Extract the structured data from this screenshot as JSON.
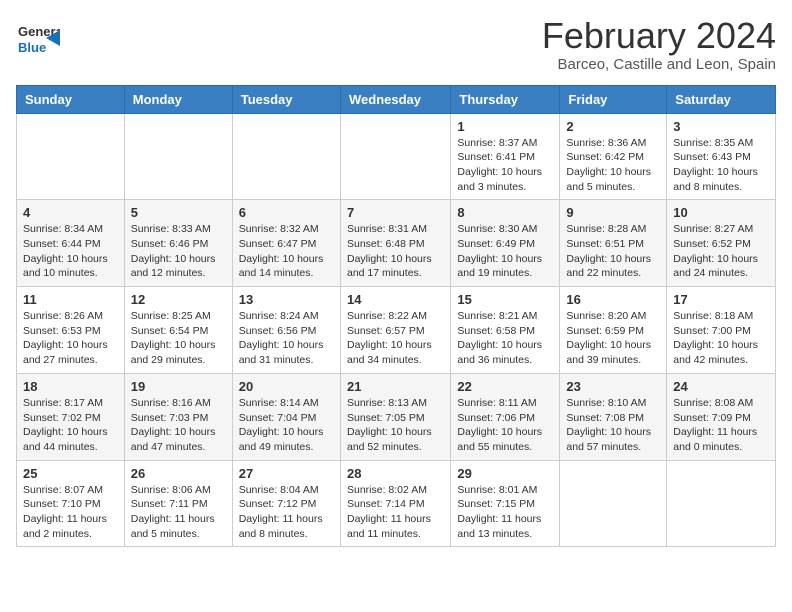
{
  "logo": {
    "text_general": "General",
    "text_blue": "Blue"
  },
  "title": "February 2024",
  "subtitle": "Barceo, Castille and Leon, Spain",
  "days_of_week": [
    "Sunday",
    "Monday",
    "Tuesday",
    "Wednesday",
    "Thursday",
    "Friday",
    "Saturday"
  ],
  "weeks": [
    [
      {
        "day": "",
        "info": ""
      },
      {
        "day": "",
        "info": ""
      },
      {
        "day": "",
        "info": ""
      },
      {
        "day": "",
        "info": ""
      },
      {
        "day": "1",
        "info": "Sunrise: 8:37 AM\nSunset: 6:41 PM\nDaylight: 10 hours\nand 3 minutes."
      },
      {
        "day": "2",
        "info": "Sunrise: 8:36 AM\nSunset: 6:42 PM\nDaylight: 10 hours\nand 5 minutes."
      },
      {
        "day": "3",
        "info": "Sunrise: 8:35 AM\nSunset: 6:43 PM\nDaylight: 10 hours\nand 8 minutes."
      }
    ],
    [
      {
        "day": "4",
        "info": "Sunrise: 8:34 AM\nSunset: 6:44 PM\nDaylight: 10 hours\nand 10 minutes."
      },
      {
        "day": "5",
        "info": "Sunrise: 8:33 AM\nSunset: 6:46 PM\nDaylight: 10 hours\nand 12 minutes."
      },
      {
        "day": "6",
        "info": "Sunrise: 8:32 AM\nSunset: 6:47 PM\nDaylight: 10 hours\nand 14 minutes."
      },
      {
        "day": "7",
        "info": "Sunrise: 8:31 AM\nSunset: 6:48 PM\nDaylight: 10 hours\nand 17 minutes."
      },
      {
        "day": "8",
        "info": "Sunrise: 8:30 AM\nSunset: 6:49 PM\nDaylight: 10 hours\nand 19 minutes."
      },
      {
        "day": "9",
        "info": "Sunrise: 8:28 AM\nSunset: 6:51 PM\nDaylight: 10 hours\nand 22 minutes."
      },
      {
        "day": "10",
        "info": "Sunrise: 8:27 AM\nSunset: 6:52 PM\nDaylight: 10 hours\nand 24 minutes."
      }
    ],
    [
      {
        "day": "11",
        "info": "Sunrise: 8:26 AM\nSunset: 6:53 PM\nDaylight: 10 hours\nand 27 minutes."
      },
      {
        "day": "12",
        "info": "Sunrise: 8:25 AM\nSunset: 6:54 PM\nDaylight: 10 hours\nand 29 minutes."
      },
      {
        "day": "13",
        "info": "Sunrise: 8:24 AM\nSunset: 6:56 PM\nDaylight: 10 hours\nand 31 minutes."
      },
      {
        "day": "14",
        "info": "Sunrise: 8:22 AM\nSunset: 6:57 PM\nDaylight: 10 hours\nand 34 minutes."
      },
      {
        "day": "15",
        "info": "Sunrise: 8:21 AM\nSunset: 6:58 PM\nDaylight: 10 hours\nand 36 minutes."
      },
      {
        "day": "16",
        "info": "Sunrise: 8:20 AM\nSunset: 6:59 PM\nDaylight: 10 hours\nand 39 minutes."
      },
      {
        "day": "17",
        "info": "Sunrise: 8:18 AM\nSunset: 7:00 PM\nDaylight: 10 hours\nand 42 minutes."
      }
    ],
    [
      {
        "day": "18",
        "info": "Sunrise: 8:17 AM\nSunset: 7:02 PM\nDaylight: 10 hours\nand 44 minutes."
      },
      {
        "day": "19",
        "info": "Sunrise: 8:16 AM\nSunset: 7:03 PM\nDaylight: 10 hours\nand 47 minutes."
      },
      {
        "day": "20",
        "info": "Sunrise: 8:14 AM\nSunset: 7:04 PM\nDaylight: 10 hours\nand 49 minutes."
      },
      {
        "day": "21",
        "info": "Sunrise: 8:13 AM\nSunset: 7:05 PM\nDaylight: 10 hours\nand 52 minutes."
      },
      {
        "day": "22",
        "info": "Sunrise: 8:11 AM\nSunset: 7:06 PM\nDaylight: 10 hours\nand 55 minutes."
      },
      {
        "day": "23",
        "info": "Sunrise: 8:10 AM\nSunset: 7:08 PM\nDaylight: 10 hours\nand 57 minutes."
      },
      {
        "day": "24",
        "info": "Sunrise: 8:08 AM\nSunset: 7:09 PM\nDaylight: 11 hours\nand 0 minutes."
      }
    ],
    [
      {
        "day": "25",
        "info": "Sunrise: 8:07 AM\nSunset: 7:10 PM\nDaylight: 11 hours\nand 2 minutes."
      },
      {
        "day": "26",
        "info": "Sunrise: 8:06 AM\nSunset: 7:11 PM\nDaylight: 11 hours\nand 5 minutes."
      },
      {
        "day": "27",
        "info": "Sunrise: 8:04 AM\nSunset: 7:12 PM\nDaylight: 11 hours\nand 8 minutes."
      },
      {
        "day": "28",
        "info": "Sunrise: 8:02 AM\nSunset: 7:14 PM\nDaylight: 11 hours\nand 11 minutes."
      },
      {
        "day": "29",
        "info": "Sunrise: 8:01 AM\nSunset: 7:15 PM\nDaylight: 11 hours\nand 13 minutes."
      },
      {
        "day": "",
        "info": ""
      },
      {
        "day": "",
        "info": ""
      }
    ]
  ]
}
